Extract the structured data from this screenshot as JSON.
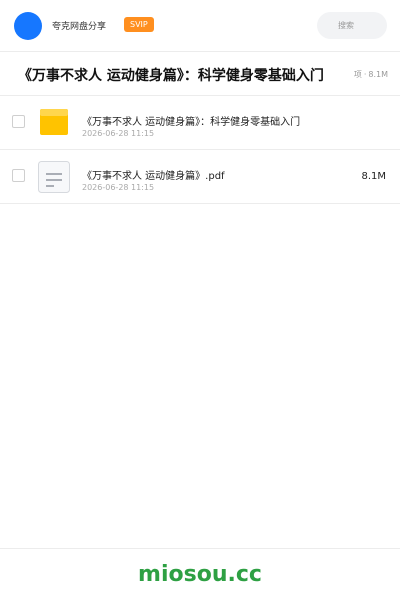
{
  "header": {
    "share_label": "夸克网盘分享",
    "svip_label": "SVIP",
    "search_placeholder": "搜索"
  },
  "title_bar": {
    "title": "《万事不求人 运动健身篇》：科学健身零基础入门",
    "item_count_suffix": "项",
    "total_size": "8.1M"
  },
  "files": [
    {
      "name": "《万事不求人 运动健身篇》：科学健身零基础入门",
      "date": "2026-06-28 11:15",
      "size": "",
      "icon": "folder-icon"
    },
    {
      "name": "《万事不求人 运动健身篇》.pdf",
      "date": "2026-06-28 11:15",
      "size": "8.1M",
      "icon": "document-icon"
    }
  ],
  "footer": {
    "logo_text": "miosou.cc"
  },
  "colors": {
    "accent_blue": "#1677ff",
    "svip_orange": "#ff8f1f",
    "folder_yellow": "#ffc300",
    "logo_green": "#2ea043"
  }
}
